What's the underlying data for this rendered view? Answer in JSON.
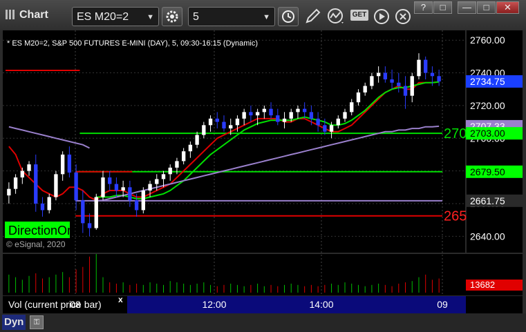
{
  "window": {
    "title": "Chart",
    "symbol": "ES M20=2",
    "interval": "5",
    "symbol_caret": "▼",
    "interval_caret": "▼",
    "controls": [
      "?",
      "□",
      "—",
      "□",
      "✕"
    ],
    "toolbar_icons": [
      "settings-icon",
      "clock-icon",
      "pencil-icon",
      "studies-icon",
      "get-icon",
      "play-icon",
      "close-circle-icon"
    ],
    "get_label": "GET"
  },
  "chart_data": {
    "type": "candlestick",
    "header": "* ES M20=2, S&P 500 FUTURES E-MINI (DAY), 5, 09:30-16:15 (Dynamic)",
    "watermark": "© eSignal, 2020",
    "brand_text": "DirectionOm",
    "brand_suffix": "om",
    "y_ticks": [
      "2760.00",
      "2740.00",
      "2720.00",
      "2700.00",
      "2680.00",
      "2660.00",
      "2640.00"
    ],
    "y_tick_values": [
      2760,
      2740,
      2720,
      2700,
      2680,
      2660,
      2640
    ],
    "ylim": [
      2630,
      2766
    ],
    "x_ticks": [
      "08",
      "12:00",
      "14:00",
      "09"
    ],
    "last_price": "2734.75",
    "price_labels": [
      {
        "text": "2734.75",
        "value": 2734.75,
        "bg": "#1a3fff",
        "fg": "#ffffff"
      },
      {
        "text": "2707.33",
        "value": 2707.33,
        "bg": "#9a80cc",
        "fg": "#ffffff"
      },
      {
        "text": "2703.00",
        "value": 2703.0,
        "bg": "#00ff00",
        "fg": "#000000"
      },
      {
        "text": "2679.50",
        "value": 2679.5,
        "bg": "#00ff00",
        "fg": "#000000"
      },
      {
        "text": "2661.75",
        "value": 2661.75,
        "bg": "#2a2a2a",
        "fg": "#ffffff"
      }
    ],
    "level_lines": [
      {
        "value": 2741.5,
        "color": "#e00000",
        "from": 0.0,
        "to": 0.17
      },
      {
        "value": 2703.0,
        "color": "#00e000",
        "from": 0.17,
        "to": 1.0,
        "label": "270",
        "label_color": "#00e000"
      },
      {
        "value": 2679.5,
        "color": "#00e000",
        "from": 0.16,
        "to": 1.0
      },
      {
        "value": 2679.5,
        "color": "#e00000",
        "from": 0.16,
        "to": 0.29
      },
      {
        "value": 2661.75,
        "color": "#9a80cc",
        "from": 0.16,
        "to": 1.0
      },
      {
        "value": 2652.5,
        "color": "#e00000",
        "from": 0.16,
        "to": 1.0,
        "label": "265",
        "label_color": "#ff2020"
      }
    ],
    "candles": [
      [
        2665,
        2673,
        2660,
        2669
      ],
      [
        2669,
        2678,
        2666,
        2676
      ],
      [
        2676,
        2682,
        2672,
        2680
      ],
      [
        2680,
        2686,
        2677,
        2684
      ],
      [
        2684,
        2690,
        2655,
        2660
      ],
      [
        2660,
        2664,
        2652,
        2656
      ],
      [
        2656,
        2666,
        2654,
        2664
      ],
      [
        2664,
        2680,
        2662,
        2678
      ],
      [
        2678,
        2692,
        2674,
        2690
      ],
      [
        2690,
        2695,
        2676,
        2679
      ],
      [
        2679,
        2684,
        2656,
        2662
      ],
      [
        2662,
        2668,
        2642,
        2648
      ],
      [
        2648,
        2654,
        2640,
        2645
      ],
      [
        2645,
        2666,
        2644,
        2664
      ],
      [
        2664,
        2680,
        2662,
        2676
      ],
      [
        2676,
        2680,
        2668,
        2672
      ],
      [
        2672,
        2676,
        2664,
        2668
      ],
      [
        2668,
        2674,
        2664,
        2670
      ],
      [
        2670,
        2674,
        2658,
        2662
      ],
      [
        2662,
        2666,
        2652,
        2656
      ],
      [
        2656,
        2670,
        2654,
        2668
      ],
      [
        2668,
        2674,
        2664,
        2672
      ],
      [
        2672,
        2678,
        2668,
        2675
      ],
      [
        2675,
        2680,
        2670,
        2678
      ],
      [
        2678,
        2684,
        2674,
        2682
      ],
      [
        2682,
        2688,
        2678,
        2686
      ],
      [
        2686,
        2694,
        2684,
        2692
      ],
      [
        2692,
        2698,
        2688,
        2696
      ],
      [
        2696,
        2704,
        2694,
        2702
      ],
      [
        2702,
        2710,
        2700,
        2708
      ],
      [
        2708,
        2714,
        2704,
        2712
      ],
      [
        2712,
        2716,
        2706,
        2710
      ],
      [
        2710,
        2714,
        2704,
        2706
      ],
      [
        2706,
        2712,
        2702,
        2708
      ],
      [
        2708,
        2714,
        2704,
        2712
      ],
      [
        2712,
        2718,
        2708,
        2716
      ],
      [
        2716,
        2720,
        2710,
        2714
      ],
      [
        2714,
        2718,
        2708,
        2716
      ],
      [
        2716,
        2720,
        2712,
        2718
      ],
      [
        2718,
        2722,
        2712,
        2714
      ],
      [
        2714,
        2718,
        2708,
        2710
      ],
      [
        2710,
        2716,
        2706,
        2712
      ],
      [
        2712,
        2718,
        2710,
        2716
      ],
      [
        2716,
        2720,
        2712,
        2718
      ],
      [
        2718,
        2722,
        2712,
        2716
      ],
      [
        2716,
        2720,
        2708,
        2712
      ],
      [
        2712,
        2716,
        2704,
        2708
      ],
      [
        2708,
        2712,
        2702,
        2704
      ],
      [
        2704,
        2710,
        2700,
        2708
      ],
      [
        2708,
        2714,
        2706,
        2712
      ],
      [
        2712,
        2718,
        2710,
        2716
      ],
      [
        2716,
        2724,
        2714,
        2722
      ],
      [
        2722,
        2730,
        2720,
        2728
      ],
      [
        2728,
        2734,
        2726,
        2732
      ],
      [
        2732,
        2740,
        2730,
        2738
      ],
      [
        2738,
        2744,
        2734,
        2740
      ],
      [
        2740,
        2744,
        2734,
        2736
      ],
      [
        2736,
        2742,
        2730,
        2734
      ],
      [
        2734,
        2740,
        2728,
        2732
      ],
      [
        2732,
        2738,
        2718,
        2726
      ],
      [
        2726,
        2740,
        2722,
        2738
      ],
      [
        2738,
        2752,
        2736,
        2748
      ],
      [
        2748,
        2750,
        2736,
        2740
      ],
      [
        2740,
        2744,
        2732,
        2738
      ],
      [
        2738,
        2742,
        2732,
        2734.75
      ]
    ],
    "series": [
      {
        "color": "#e00000",
        "values": [
          2695,
          2690,
          2680,
          2676,
          2672,
          2668,
          2666,
          2664,
          2666,
          2670,
          2670,
          2668,
          2664,
          2662,
          2666,
          2668,
          2668,
          2668,
          2666,
          2664,
          2664,
          2666,
          2668,
          2670,
          2672,
          2676,
          2680,
          2684,
          2688,
          2692,
          2696,
          2700,
          2702,
          2704,
          2706,
          2708,
          2710,
          2712,
          2712,
          2712,
          2712,
          2710,
          2710,
          2712,
          2712,
          2710,
          2708,
          2706,
          2704,
          2704,
          2706,
          2708,
          2712,
          2716,
          2720,
          2724,
          2728,
          2730,
          2732,
          2730,
          2730,
          2734,
          2734,
          2734,
          2734.5
        ]
      },
      {
        "color": "#00e000",
        "values": [
          null,
          null,
          null,
          null,
          null,
          null,
          null,
          null,
          null,
          null,
          null,
          null,
          null,
          2664,
          2664,
          2664,
          2665,
          2665,
          2664,
          2663,
          2663,
          2664,
          2665,
          2666,
          2668,
          2671,
          2674,
          2678,
          2682,
          2686,
          2690,
          2693,
          2696,
          2699,
          2702,
          2705,
          2707,
          2709,
          2710,
          2711,
          2711,
          2711,
          2711,
          2712,
          2713,
          2712,
          2711,
          2710,
          2708,
          2708,
          2709,
          2711,
          2714,
          2717,
          2721,
          2725,
          2728,
          2730,
          2731,
          2731,
          2732,
          2733,
          2734,
          2734,
          2734.5
        ]
      },
      {
        "color": "#9a80cc",
        "values": [
          2707,
          2706,
          2705,
          2704,
          2703,
          2702,
          2701,
          2700,
          2699,
          2698,
          2697,
          2696,
          2694,
          null,
          null,
          null,
          null,
          null,
          null,
          null,
          null,
          null,
          null,
          null,
          null,
          null,
          null,
          null,
          null,
          null,
          null,
          null,
          null,
          null,
          null,
          null,
          null,
          null,
          null,
          null,
          null,
          null,
          null,
          null,
          null,
          null,
          null,
          null,
          null,
          null,
          null,
          null,
          null,
          null,
          null,
          null,
          null,
          null,
          null,
          null,
          null,
          null,
          null,
          null,
          null
        ]
      },
      {
        "color": "#9a80cc",
        "values": [
          null,
          null,
          null,
          null,
          null,
          null,
          null,
          null,
          null,
          null,
          null,
          null,
          null,
          2661.75,
          2662,
          2663,
          2664,
          2665,
          2666,
          2667,
          2668,
          2669,
          2670,
          2671,
          2672,
          2673,
          2674,
          2675,
          2676,
          2677,
          2678,
          2679,
          2680,
          2681,
          2682,
          2683,
          2684,
          2685,
          2686,
          2687,
          2688,
          2689,
          2690,
          2691,
          2692,
          2693,
          2694,
          2695,
          2696,
          2697,
          2698,
          2699,
          2700,
          2701,
          2702,
          2703,
          2704,
          2704,
          2705,
          2705,
          2706,
          2706,
          2707,
          2707,
          2707.33
        ]
      }
    ],
    "volume": {
      "label": "Vol (current price bar)",
      "close_label": "x",
      "last": "13682",
      "values": [
        14,
        12,
        10,
        13,
        15,
        11,
        12,
        14,
        16,
        12,
        18,
        20,
        28,
        30,
        12,
        8,
        7,
        8,
        6,
        7,
        6,
        8,
        7,
        6,
        9,
        8,
        7,
        6,
        7,
        8,
        6,
        5,
        6,
        7,
        6,
        5,
        6,
        7,
        5,
        6,
        5,
        6,
        7,
        6,
        5,
        6,
        5,
        6,
        7,
        6,
        8,
        7,
        6,
        5,
        6,
        7,
        6,
        5,
        7,
        8,
        9,
        12,
        14,
        10,
        11
      ]
    },
    "dynamic_label": "Dyn"
  }
}
